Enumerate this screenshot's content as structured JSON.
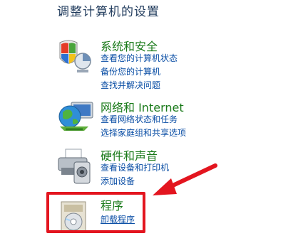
{
  "page": {
    "title": "调整计算机的设置"
  },
  "categories": [
    {
      "title": "系统和安全",
      "icon": "shield-flag-icon",
      "links": [
        "查看您的计算机状态",
        "备份您的计算机",
        "查找并解决问题"
      ]
    },
    {
      "title": "网络和 Internet",
      "icon": "globe-network-icon",
      "links": [
        "查看网络状态和任务",
        "选择家庭组和共享选项"
      ]
    },
    {
      "title": "硬件和声音",
      "icon": "printer-speaker-icon",
      "links": [
        "查看设备和打印机",
        "添加设备"
      ]
    },
    {
      "title": "程序",
      "icon": "programs-disc-icon",
      "links": [
        "卸载程序"
      ]
    }
  ],
  "annotation": {
    "highlight_color": "#e3151f",
    "arrow_color": "#e3151f"
  }
}
